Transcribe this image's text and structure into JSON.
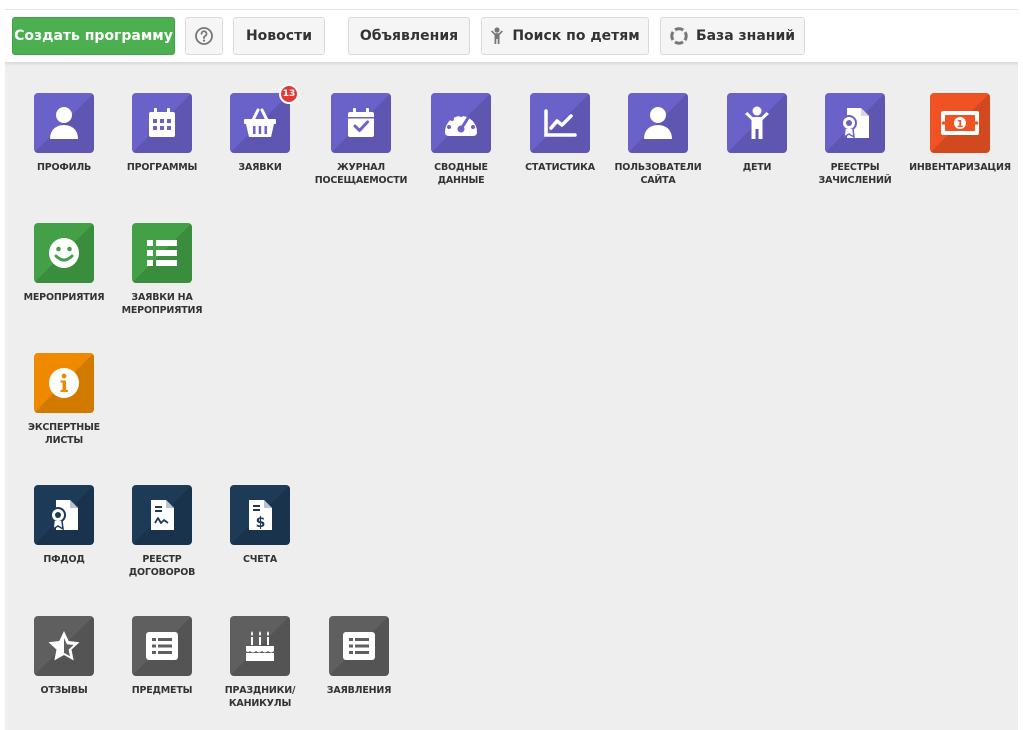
{
  "toolbar": {
    "create_program": "Создать программу",
    "news": "Новости",
    "announcements": "Объявления",
    "child_search": "Поиск по детям",
    "knowledge_base": "База знаний"
  },
  "tiles": {
    "profile": {
      "label": "Профиль",
      "icon": "user-icon",
      "color": "#6b62c9"
    },
    "programs": {
      "label": "Программы",
      "icon": "calendar-grid-icon",
      "color": "#6b62c9"
    },
    "applications": {
      "label": "Заявки",
      "icon": "basket-icon",
      "color": "#6b62c9",
      "badge": "13"
    },
    "attendance": {
      "label1": "Журнал",
      "label2": "посещаемости",
      "icon": "calendar-check-icon",
      "color": "#6b62c9"
    },
    "summary": {
      "label1": "Сводные",
      "label2": "данные",
      "icon": "gauge-icon",
      "color": "#6b62c9"
    },
    "statistics": {
      "label": "Статистика",
      "icon": "chart-icon",
      "color": "#6b62c9"
    },
    "site_users": {
      "label1": "Пользователи",
      "label2": "сайта",
      "icon": "user-icon",
      "color": "#6b62c9"
    },
    "children": {
      "label": "Дети",
      "icon": "child-icon",
      "color": "#6b62c9"
    },
    "enrollment_registers": {
      "label1": "Реестры",
      "label2": "зачислений",
      "icon": "certificate-doc-icon",
      "color": "#6b62c9"
    },
    "inventory": {
      "label": "Инвентаризация",
      "icon": "money-icon",
      "color": "#ef5323"
    },
    "events": {
      "label": "Мероприятия",
      "icon": "smile-icon",
      "color": "#43a047"
    },
    "event_applications": {
      "label1": "Заявки на",
      "label2": "мероприятия",
      "icon": "list-icon",
      "color": "#43a047"
    },
    "expert_sheets": {
      "label1": "Экспертные",
      "label2": "листы",
      "icon": "info-icon",
      "color": "#ef8a00"
    },
    "pfdod": {
      "label": "ПФДОД",
      "icon": "certificate-doc-icon",
      "color": "#1d3a57"
    },
    "contracts": {
      "label1": "Реестр",
      "label2": "договоров",
      "icon": "contract-icon",
      "color": "#1d3a57"
    },
    "invoices": {
      "label": "Счета",
      "icon": "invoice-icon",
      "color": "#1d3a57"
    },
    "reviews": {
      "label": "Отзывы",
      "icon": "star-icon",
      "color": "#5f5f5f"
    },
    "subjects": {
      "label": "Предметы",
      "icon": "list-box-icon",
      "color": "#5f5f5f"
    },
    "holidays": {
      "label1": "Праздники/",
      "label2": "каникулы",
      "icon": "cake-icon",
      "color": "#5f5f5f"
    },
    "statements": {
      "label": "Заявления",
      "icon": "list-box-icon",
      "color": "#5f5f5f"
    }
  }
}
